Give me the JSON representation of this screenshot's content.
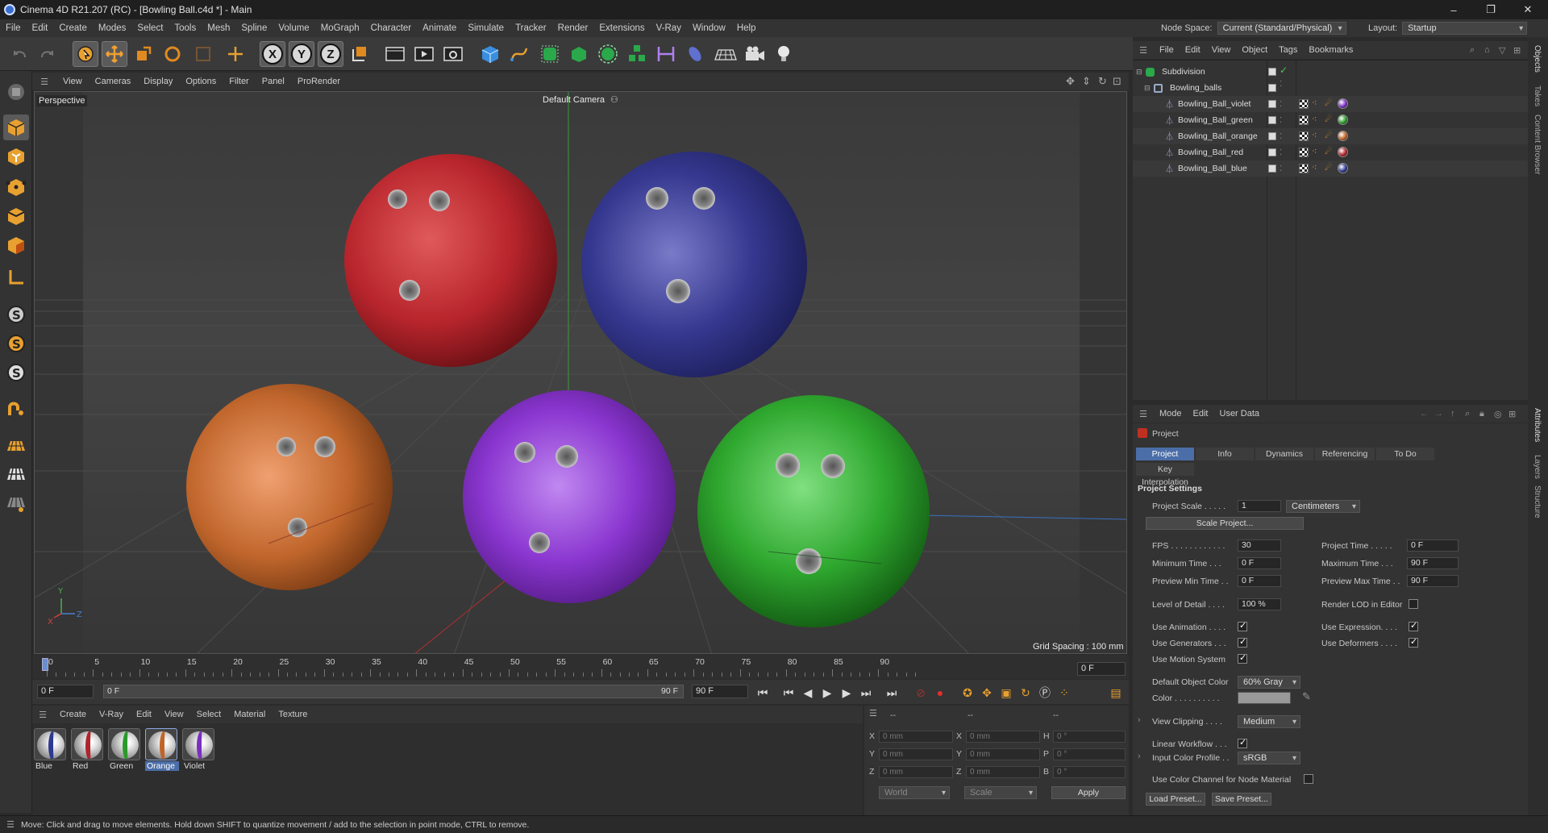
{
  "window": {
    "title": "Cinema 4D R21.207 (RC) - [Bowling Ball.c4d *] - Main"
  },
  "menubar": {
    "items": [
      "File",
      "Edit",
      "Create",
      "Modes",
      "Select",
      "Tools",
      "Mesh",
      "Spline",
      "Volume",
      "MoGraph",
      "Character",
      "Animate",
      "Simulate",
      "Tracker",
      "Render",
      "Extensions",
      "V-Ray",
      "Window",
      "Help"
    ],
    "node_space_label": "Node Space:",
    "node_space_value": "Current (Standard/Physical)",
    "layout_label": "Layout:",
    "layout_value": "Startup"
  },
  "viewport": {
    "menu": [
      "View",
      "Cameras",
      "Display",
      "Options",
      "Filter",
      "Panel",
      "ProRender"
    ],
    "view_name": "Perspective",
    "camera": "Default Camera",
    "grid_spacing": "Grid Spacing : 100 mm"
  },
  "timeline": {
    "ticks": [
      "0",
      "5",
      "10",
      "15",
      "20",
      "25",
      "30",
      "35",
      "40",
      "45",
      "50",
      "55",
      "60",
      "65",
      "70",
      "75",
      "80",
      "85",
      "90"
    ],
    "current_frame": "0 F",
    "start_field": "0 F",
    "range_start": "0 F",
    "range_end": "90 F",
    "end_field": "90 F"
  },
  "materials": {
    "menu": [
      "Create",
      "V-Ray",
      "Edit",
      "View",
      "Select",
      "Material",
      "Texture"
    ],
    "items": [
      {
        "name": "Blue",
        "color": "#2f3a8f"
      },
      {
        "name": "Red",
        "color": "#b0242c"
      },
      {
        "name": "Green",
        "color": "#2a9a2a"
      },
      {
        "name": "Orange",
        "color": "#c06428",
        "selected": true
      },
      {
        "name": "Violet",
        "color": "#7a2fc0"
      }
    ]
  },
  "coordinates": {
    "header": [
      "--",
      "--",
      "--"
    ],
    "rows": [
      {
        "a": "X",
        "av": "0 mm",
        "b": "X",
        "bv": "0 mm",
        "c": "H",
        "cv": "0 °"
      },
      {
        "a": "Y",
        "av": "0 mm",
        "b": "Y",
        "bv": "0 mm",
        "c": "P",
        "cv": "0 °"
      },
      {
        "a": "Z",
        "av": "0 mm",
        "b": "Z",
        "bv": "0 mm",
        "c": "B",
        "cv": "0 °"
      }
    ],
    "mode": "World",
    "scale_mode": "Scale",
    "apply": "Apply"
  },
  "status": "Move: Click and drag to move elements. Hold down SHIFT to quantize movement / add to the selection in point mode, CTRL to remove.",
  "objects": {
    "menu": [
      "File",
      "Edit",
      "View",
      "Object",
      "Tags",
      "Bookmarks"
    ],
    "items": [
      {
        "name": "Subdivision",
        "indent": 0
      },
      {
        "name": "Bowling_balls",
        "indent": 1
      },
      {
        "name": "Bowling_Ball_violet",
        "indent": 2,
        "tag": "#7a2fc0"
      },
      {
        "name": "Bowling_Ball_green",
        "indent": 2,
        "tag": "#2a9a2a"
      },
      {
        "name": "Bowling_Ball_orange",
        "indent": 2,
        "tag": "#c06428"
      },
      {
        "name": "Bowling_Ball_red",
        "indent": 2,
        "tag": "#b0242c"
      },
      {
        "name": "Bowling_Ball_blue",
        "indent": 2,
        "tag": "#2f3a8f"
      }
    ]
  },
  "attributes": {
    "menu": [
      "Mode",
      "Edit",
      "User Data"
    ],
    "object_name": "Project",
    "tabs": [
      "Project Settings",
      "Info",
      "Dynamics",
      "Referencing",
      "To Do"
    ],
    "tab2": "Key Interpolation",
    "section": "Project Settings",
    "project_scale_label": "Project Scale . . . . .",
    "project_scale_value": "1",
    "project_scale_unit": "Centimeters",
    "scale_project_btn": "Scale Project...",
    "fps_label": "FPS . . . . . . . . . . . .",
    "fps_value": "30",
    "project_time_label": "Project Time . . . . .",
    "project_time_value": "0 F",
    "min_time_label": "Minimum Time . . .",
    "min_time_value": "0 F",
    "max_time_label": "Maximum Time . . .",
    "max_time_value": "90 F",
    "prev_min_label": "Preview Min Time . .",
    "prev_min_value": "0 F",
    "prev_max_label": "Preview Max Time . .",
    "prev_max_value": "90 F",
    "lod_label": "Level of Detail . . . .",
    "lod_value": "100 %",
    "render_lod_label": "Render LOD in Editor",
    "use_anim_label": "Use Animation . . . .",
    "use_expr_label": "Use Expression. . . .",
    "use_gen_label": "Use Generators . . .",
    "use_def_label": "Use Deformers . . . .",
    "use_motion_label": "Use Motion System",
    "default_color_label": "Default Object Color",
    "default_color_value": "60% Gray",
    "color_label": "Color . . . . . . . . . .",
    "view_clip_label": "View Clipping . . . .",
    "view_clip_value": "Medium",
    "linear_wf_label": "Linear Workflow . . .",
    "input_profile_label": "Input Color Profile . .",
    "input_profile_value": "sRGB",
    "use_color_channel_label": "Use Color Channel for Node Material",
    "load_preset": "Load Preset...",
    "save_preset": "Save Preset..."
  },
  "side_tabs": [
    "Objects",
    "Takes",
    "Content Browser",
    "Attributes",
    "Layers",
    "Structure"
  ]
}
